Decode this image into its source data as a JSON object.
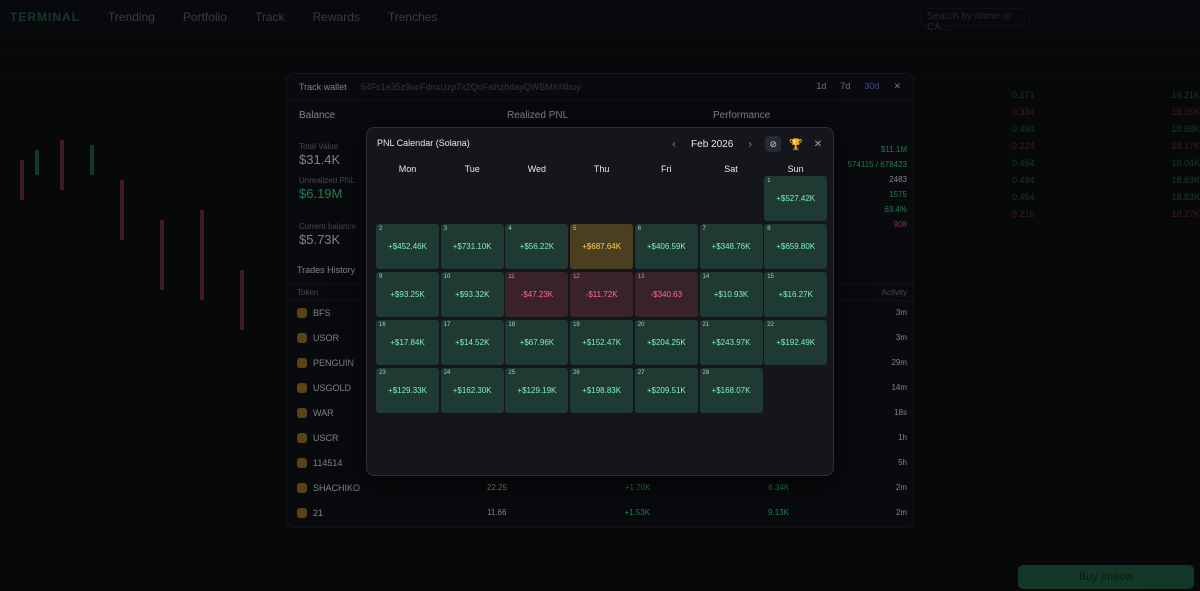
{
  "app": {
    "logo": "TERMINAL",
    "nav": [
      "Trending",
      "Portfolio",
      "Track",
      "Rewards",
      "Trenches"
    ],
    "search_placeholder": "Search by name or CA...",
    "buy_button": "Buy Imeow"
  },
  "track_wallet": {
    "title": "Track wallet",
    "address": "54Fc1e35z9uoFdnxUzp7x2QoFsihzhdayQWBMKf4buy",
    "ranges": [
      "1d",
      "7d",
      "30d"
    ],
    "active_range": "30d",
    "balance": {
      "title": "Balance",
      "total_value_label": "Total Value",
      "total_value": "$31.4K",
      "unrealized_label": "Unrealized PNL",
      "unrealized_value": "$6.19M",
      "current_label": "Current balance",
      "current_value": "$5.73K"
    },
    "realized_pnl_title": "Realized PNL",
    "performance": {
      "title": "Performance",
      "values": [
        "$11.1M",
        "574115 / 678423",
        "2483",
        "1575",
        "63.4%",
        "908"
      ]
    },
    "trades_history_title": "Trades History",
    "columns": [
      "Token",
      "Activity"
    ],
    "trades": [
      {
        "token": "BFS",
        "activity": "3m"
      },
      {
        "token": "USOR",
        "activity": "3m"
      },
      {
        "token": "PENGUIN",
        "activity": "29m"
      },
      {
        "token": "USGOLD",
        "activity": "14m"
      },
      {
        "token": "WAR",
        "activity": "18s"
      },
      {
        "token": "USCR",
        "activity": "1h"
      },
      {
        "token": "114514",
        "activity": "5h"
      },
      {
        "token": "SHACHIKO",
        "activity": "2m",
        "v1": "22.25",
        "v2": "+1.70K",
        "v3": "6.34K"
      },
      {
        "token": "21",
        "activity": "2m",
        "v1": "11.66",
        "v2": "+1.53K",
        "v3": "9.13K"
      }
    ]
  },
  "calendar": {
    "title": "PNL Calendar (Solana)",
    "month": "Feb 2026",
    "weekdays": [
      "Mon",
      "Tue",
      "Wed",
      "Thu",
      "Fri",
      "Sat",
      "Sun"
    ],
    "days": [
      {
        "day": "1",
        "value": "+$527.42K",
        "kind": "pos"
      },
      {
        "day": "2",
        "value": "+$452.46K",
        "kind": "pos"
      },
      {
        "day": "3",
        "value": "+$731.10K",
        "kind": "pos"
      },
      {
        "day": "4",
        "value": "+$56.22K",
        "kind": "pos"
      },
      {
        "day": "5",
        "value": "+$687.64K",
        "kind": "best"
      },
      {
        "day": "6",
        "value": "+$406.59K",
        "kind": "pos"
      },
      {
        "day": "7",
        "value": "+$348.76K",
        "kind": "pos"
      },
      {
        "day": "8",
        "value": "+$659.80K",
        "kind": "pos"
      },
      {
        "day": "9",
        "value": "+$93.25K",
        "kind": "pos"
      },
      {
        "day": "10",
        "value": "+$93.32K",
        "kind": "pos"
      },
      {
        "day": "11",
        "value": "-$47.23K",
        "kind": "neg"
      },
      {
        "day": "12",
        "value": "-$11.72K",
        "kind": "neg"
      },
      {
        "day": "13",
        "value": "-$340.63",
        "kind": "neg"
      },
      {
        "day": "14",
        "value": "+$10.93K",
        "kind": "pos"
      },
      {
        "day": "15",
        "value": "+$16.27K",
        "kind": "pos"
      },
      {
        "day": "16",
        "value": "+$17.84K",
        "kind": "pos"
      },
      {
        "day": "17",
        "value": "+$14.52K",
        "kind": "pos"
      },
      {
        "day": "18",
        "value": "+$67.96K",
        "kind": "pos"
      },
      {
        "day": "19",
        "value": "+$152.47K",
        "kind": "pos"
      },
      {
        "day": "20",
        "value": "+$204.25K",
        "kind": "pos"
      },
      {
        "day": "21",
        "value": "+$243.97K",
        "kind": "pos"
      },
      {
        "day": "22",
        "value": "+$192.49K",
        "kind": "pos"
      },
      {
        "day": "23",
        "value": "+$129.33K",
        "kind": "pos"
      },
      {
        "day": "24",
        "value": "+$162.30K",
        "kind": "pos"
      },
      {
        "day": "25",
        "value": "+$129.19K",
        "kind": "pos"
      },
      {
        "day": "26",
        "value": "+$198.83K",
        "kind": "pos"
      },
      {
        "day": "27",
        "value": "+$209.51K",
        "kind": "pos"
      },
      {
        "day": "28",
        "value": "+$168.07K",
        "kind": "pos"
      }
    ],
    "first_weekday_index": 6
  }
}
